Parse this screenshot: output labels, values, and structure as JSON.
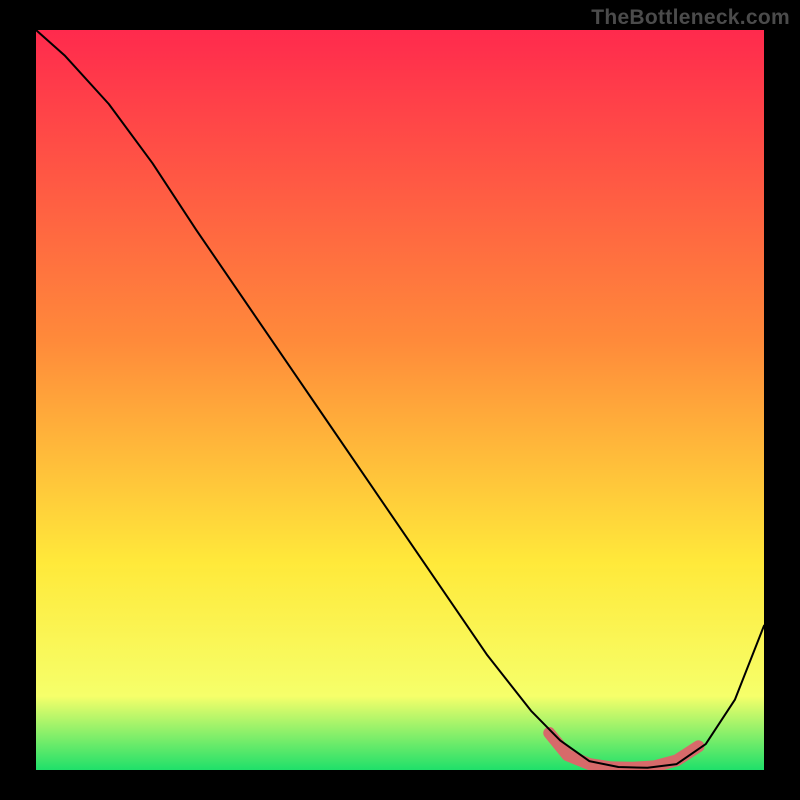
{
  "watermark": "TheBottleneck.com",
  "chart_data": {
    "type": "line",
    "title": "",
    "xlabel": "",
    "ylabel": "",
    "xlim": [
      0,
      100
    ],
    "ylim": [
      0,
      100
    ],
    "grid": false,
    "legend": false,
    "gradient": {
      "top": "#ff2a4d",
      "mid_upper": "#ff8a3a",
      "mid": "#ffe93a",
      "mid_lower": "#f6ff6a",
      "bottom": "#1fe06a"
    },
    "series": [
      {
        "name": "curve",
        "color": "#000000",
        "stroke_width": 2,
        "x": [
          0,
          4,
          10,
          16,
          22,
          30,
          38,
          46,
          54,
          62,
          68,
          72,
          76,
          80,
          84,
          88,
          92,
          96,
          100
        ],
        "y": [
          100,
          96.5,
          90,
          82,
          73,
          61.5,
          50,
          38.5,
          27,
          15.5,
          8,
          4,
          1.2,
          0.4,
          0.3,
          0.8,
          3.5,
          9.5,
          19.5
        ]
      },
      {
        "name": "highlight-band",
        "color": "#d76a6a",
        "stroke_width": 12,
        "linecap": "round",
        "x": [
          70.5,
          73,
          76,
          79,
          82,
          85,
          88,
          91
        ],
        "y": [
          5.0,
          2.0,
          0.8,
          0.35,
          0.3,
          0.5,
          1.3,
          3.2
        ]
      }
    ],
    "annotations": []
  }
}
